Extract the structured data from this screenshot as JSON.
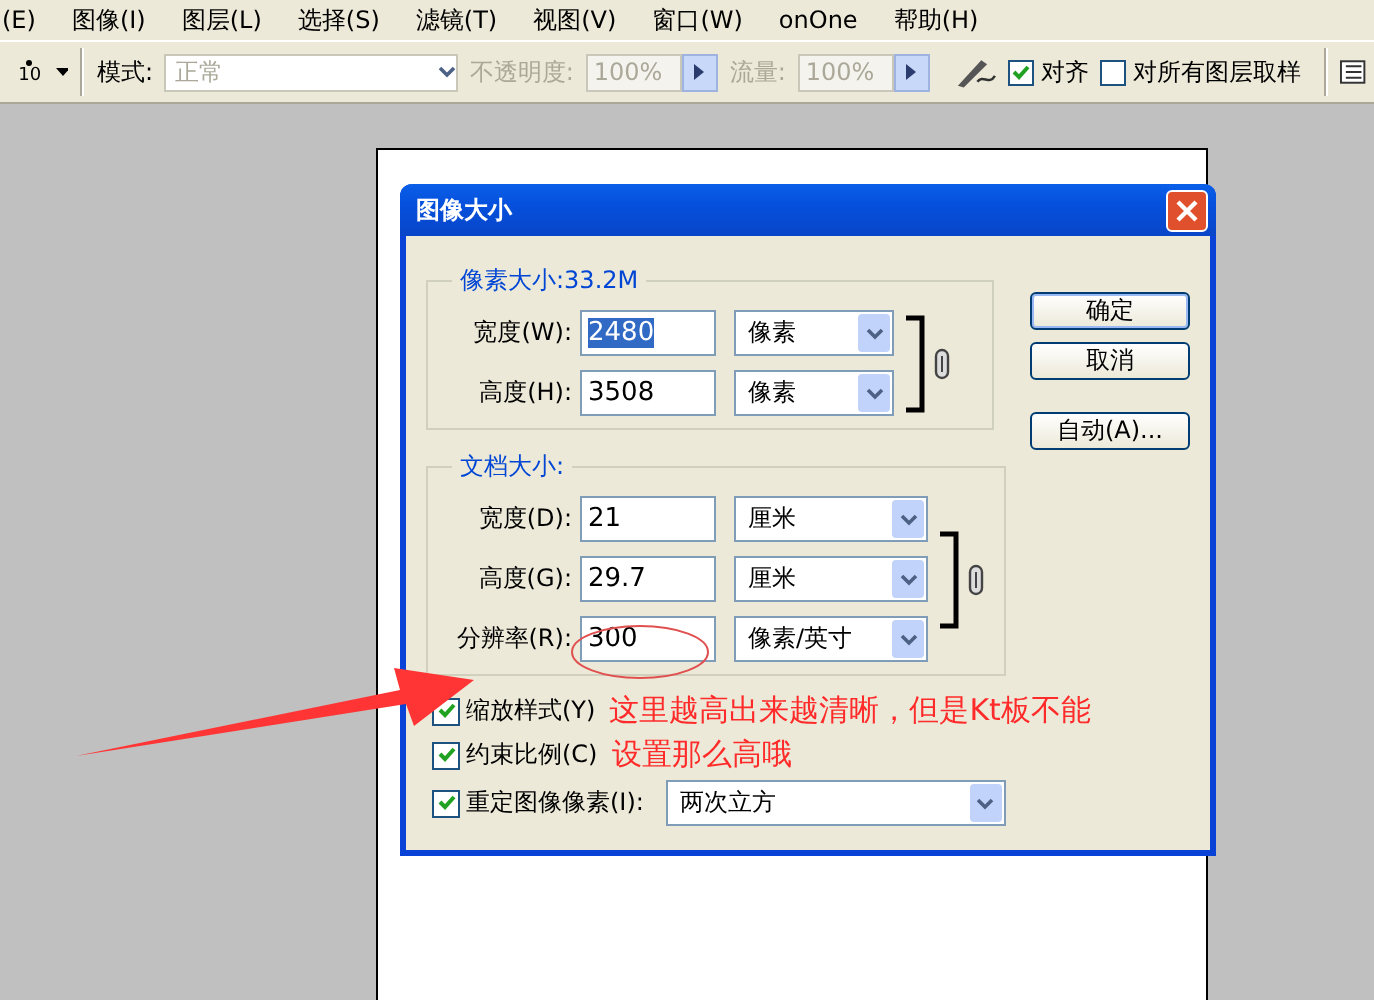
{
  "menu": [
    {
      "label": "(E)"
    },
    {
      "label": "图像(I)"
    },
    {
      "label": "图层(L)"
    },
    {
      "label": "选择(S)"
    },
    {
      "label": "滤镜(T)"
    },
    {
      "label": "视图(V)"
    },
    {
      "label": "窗口(W)"
    },
    {
      "label": "onOne"
    },
    {
      "label": "帮助(H)"
    }
  ],
  "toolbar": {
    "brush_size": "10",
    "mode_label": "模式:",
    "mode": {
      "value": "正常",
      "disabled": true
    },
    "opacity_label": "不透明度:",
    "opacity": {
      "value": "100%",
      "disabled": true
    },
    "flow_label": "流量:",
    "flow": {
      "value": "100%",
      "disabled": true
    },
    "options": [
      {
        "label": "对齐",
        "checked": true
      },
      {
        "label": "对所有图层取样",
        "checked": false
      }
    ]
  },
  "dialog": {
    "title": "图像大小",
    "groups": [
      {
        "title": "像素大小:33.2M",
        "linked": true,
        "rows": [
          {
            "label": "宽度(W):",
            "value": "2480",
            "text_selected": true,
            "unit": "像素"
          },
          {
            "label": "高度(H):",
            "value": "3508",
            "text_selected": false,
            "unit": "像素"
          }
        ]
      },
      {
        "title": "文档大小:",
        "linked": true,
        "rows": [
          {
            "label": "宽度(D):",
            "value": "21",
            "text_selected": false,
            "unit": "厘米"
          },
          {
            "label": "高度(G):",
            "value": "29.7",
            "text_selected": false,
            "unit": "厘米"
          },
          {
            "label": "分辨率(R):",
            "value": "300",
            "text_selected": false,
            "unit": "像素/英寸"
          }
        ]
      }
    ],
    "checks": [
      {
        "label": "缩放样式(Y)",
        "checked": true,
        "note": "这里越高出来越清晰，但是Kt板不能"
      },
      {
        "label": "约束比例(C)",
        "checked": true,
        "note": "设置那么高哦"
      },
      {
        "label": "重定图像像素(I):",
        "checked": true,
        "select": "两次立方"
      }
    ],
    "buttons": [
      {
        "label": "确定",
        "default": true
      },
      {
        "label": "取消",
        "default": false
      },
      {
        "label": "自动(A)...",
        "default": false
      }
    ]
  }
}
